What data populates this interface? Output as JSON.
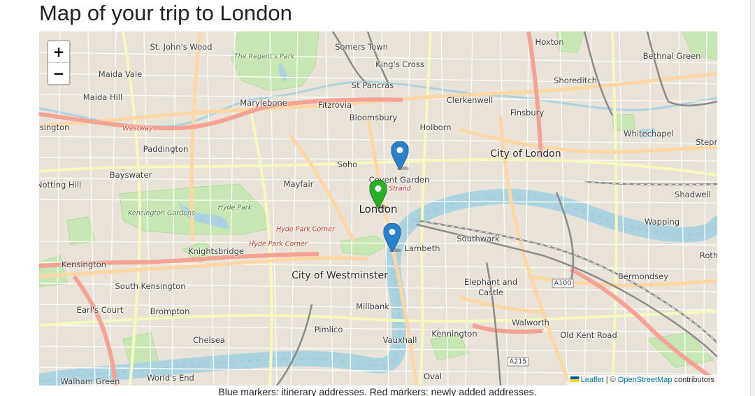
{
  "page": {
    "title": "Map of your trip to London",
    "caption": "Blue markers: itinerary addresses. Red markers: newly added addresses."
  },
  "map": {
    "zoom_in": "+",
    "zoom_out": "−",
    "attribution": {
      "leaflet": "Leaflet",
      "separator": "| ©",
      "osm": "OpenStreetMap",
      "contributors": "contributors"
    },
    "marker_colors": {
      "blue": "#2a81cb",
      "green": "#2aad27"
    },
    "labels": [
      {
        "text": "St. John's Wood",
        "kind": "minor"
      },
      {
        "text": "Somers Town",
        "kind": "minor"
      },
      {
        "text": "Hoxton",
        "kind": "minor"
      },
      {
        "text": "Bethnal Green",
        "kind": "minor"
      },
      {
        "text": "The Regent's Park",
        "kind": "park"
      },
      {
        "text": "King's Cross",
        "kind": "minor"
      },
      {
        "text": "Maida Vale",
        "kind": "minor"
      },
      {
        "text": "Shoreditch",
        "kind": "minor"
      },
      {
        "text": "St Pancras",
        "kind": "minor"
      },
      {
        "text": "Maida Hill",
        "kind": "minor"
      },
      {
        "text": "Marylebone",
        "kind": "minor"
      },
      {
        "text": "Fitzrovia",
        "kind": "minor"
      },
      {
        "text": "Clerkenwell",
        "kind": "minor"
      },
      {
        "text": "Finsbury",
        "kind": "minor"
      },
      {
        "text": "Bloomsbury",
        "kind": "minor"
      },
      {
        "text": "Holborn",
        "kind": "minor"
      },
      {
        "text": "sington",
        "kind": "minor"
      },
      {
        "text": "Westway",
        "kind": "red"
      },
      {
        "text": "Whitechapel",
        "kind": "minor"
      },
      {
        "text": "Stepn",
        "kind": "minor"
      },
      {
        "text": "Paddington",
        "kind": "minor"
      },
      {
        "text": "City of London",
        "kind": "major"
      },
      {
        "text": "Soho",
        "kind": "minor"
      },
      {
        "text": "Bayswater",
        "kind": "minor"
      },
      {
        "text": "Covent Garden",
        "kind": "minor"
      },
      {
        "text": "Notting Hill",
        "kind": "minor"
      },
      {
        "text": "Mayfair",
        "kind": "minor"
      },
      {
        "text": "Strand",
        "kind": "red"
      },
      {
        "text": "Shadwell",
        "kind": "minor"
      },
      {
        "text": "Kensington Gardens",
        "kind": "park"
      },
      {
        "text": "Hyde Park",
        "kind": "park"
      },
      {
        "text": "London",
        "kind": "city"
      },
      {
        "text": "Wapping",
        "kind": "minor"
      },
      {
        "text": "Hyde Park Corner",
        "kind": "red"
      },
      {
        "text": "Hyde Park Corner",
        "kind": "red"
      },
      {
        "text": "Southwark",
        "kind": "minor"
      },
      {
        "text": "Lambeth",
        "kind": "minor"
      },
      {
        "text": "Knightsbridge",
        "kind": "minor"
      },
      {
        "text": "Kensington",
        "kind": "minor"
      },
      {
        "text": "Roth",
        "kind": "minor"
      },
      {
        "text": "City of Westminster",
        "kind": "major"
      },
      {
        "text": "Bermondsey",
        "kind": "minor"
      },
      {
        "text": "A100",
        "kind": "shield"
      },
      {
        "text": "South Kensington",
        "kind": "minor"
      },
      {
        "text": "Elephant and",
        "kind": "minor"
      },
      {
        "text": "Castle",
        "kind": "minor"
      },
      {
        "text": "Earl's Court",
        "kind": "minor"
      },
      {
        "text": "Brompton",
        "kind": "minor"
      },
      {
        "text": "Millbank",
        "kind": "minor"
      },
      {
        "text": "Walworth",
        "kind": "minor"
      },
      {
        "text": "Old Kent Road",
        "kind": "minor"
      },
      {
        "text": "Pimlico",
        "kind": "minor"
      },
      {
        "text": "Kennington",
        "kind": "minor"
      },
      {
        "text": "Chelsea",
        "kind": "minor"
      },
      {
        "text": "Vauxhall",
        "kind": "minor"
      },
      {
        "text": "A215",
        "kind": "shield"
      },
      {
        "text": "Walham Green",
        "kind": "minor"
      },
      {
        "text": "World's End",
        "kind": "minor"
      },
      {
        "text": "Oval",
        "kind": "minor"
      }
    ]
  }
}
